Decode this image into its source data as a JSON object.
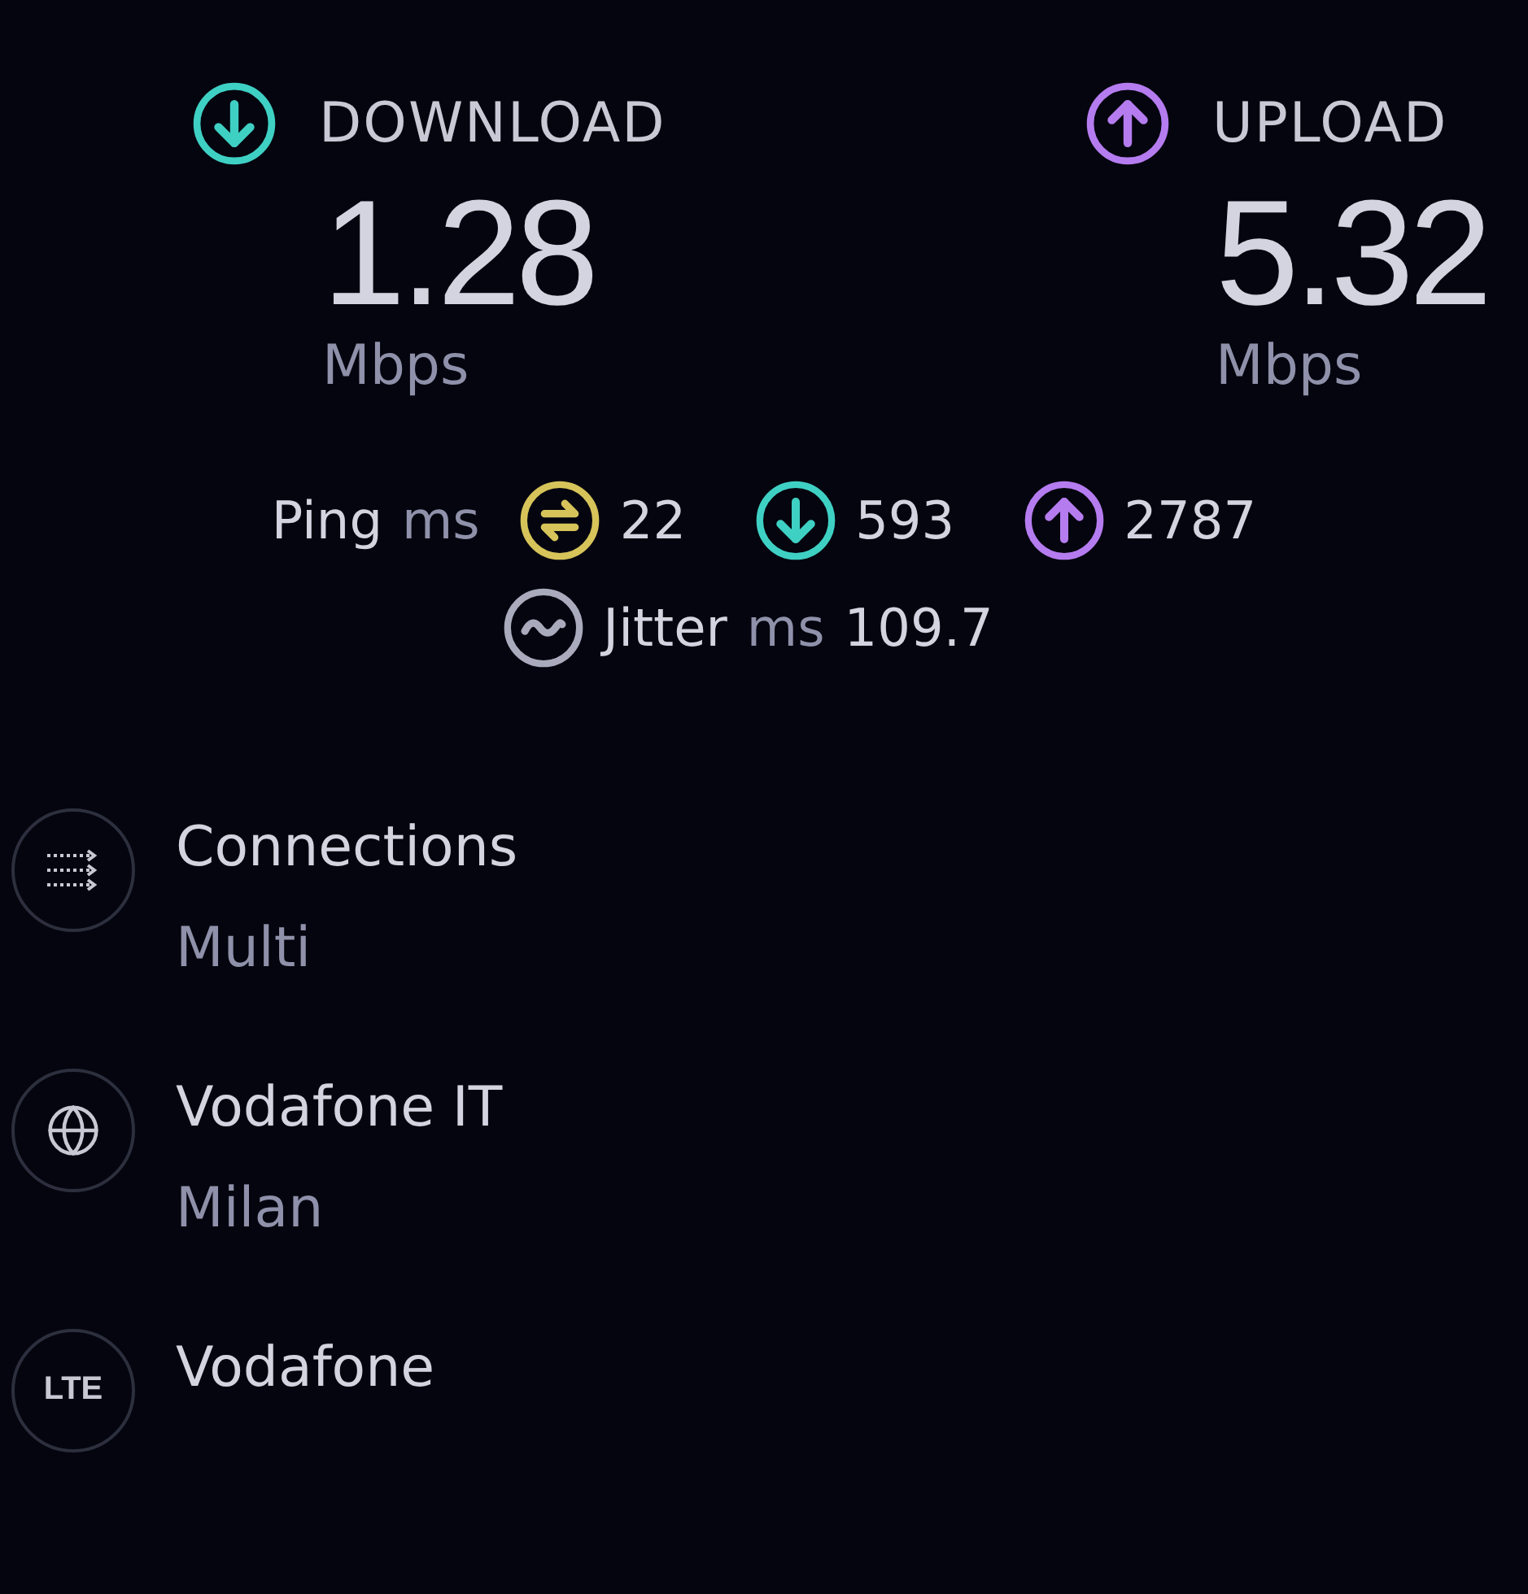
{
  "metrics": [
    {
      "kind": "download",
      "label": "DOWNLOAD",
      "value": "1.28",
      "unit": "Mbps"
    },
    {
      "kind": "upload",
      "label": "UPLOAD",
      "value": "5.32",
      "unit": "Mbps"
    }
  ],
  "ping": {
    "label": "Ping",
    "unit": "ms",
    "idle": "22",
    "download": "593",
    "upload": "2787"
  },
  "jitter": {
    "label": "Jitter",
    "unit": "ms",
    "value": "109.7"
  },
  "details": [
    {
      "kind": "connections",
      "title": "Connections",
      "subtitle": "Multi"
    },
    {
      "kind": "server",
      "title": "Vodafone IT",
      "subtitle": "Milan"
    },
    {
      "kind": "network",
      "icon_text": "LTE",
      "title": "Vodafone"
    }
  ]
}
